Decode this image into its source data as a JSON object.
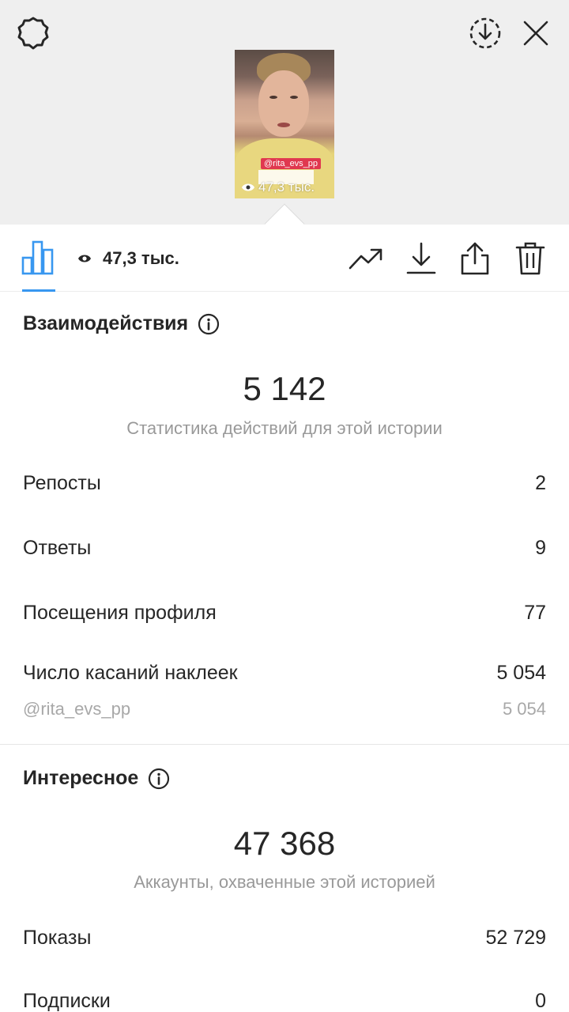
{
  "viewer": {
    "settings_icon": "gear-icon",
    "save_icon": "download-circle-icon",
    "close_icon": "close-icon",
    "thumbnail": {
      "sticker_text": "@rita_evs_pp",
      "views_text": "47,3 тыс."
    }
  },
  "toolbar": {
    "views_count": "47,3 тыс.",
    "icons": [
      "bar-chart-icon",
      "eye-icon",
      "trending-icon",
      "download-icon",
      "share-icon",
      "trash-icon"
    ],
    "accent_color": "#3897f0"
  },
  "interactions": {
    "title": "Взаимодействия",
    "total": "5 142",
    "subtitle": "Статистика действий для этой истории",
    "rows": [
      {
        "label": "Репосты",
        "value": "2"
      },
      {
        "label": "Ответы",
        "value": "9"
      },
      {
        "label": "Посещения профиля",
        "value": "77"
      },
      {
        "label": "Число касаний наклеек",
        "value": "5 054"
      }
    ],
    "sticker_row": {
      "label": "@rita_evs_pp",
      "value": "5 054"
    }
  },
  "discovery": {
    "title": "Интересное",
    "total": "47 368",
    "subtitle": "Аккаунты, охваченные этой историей",
    "rows": [
      {
        "label": "Показы",
        "value": "52 729"
      },
      {
        "label": "Подписки",
        "value": "0"
      }
    ]
  }
}
